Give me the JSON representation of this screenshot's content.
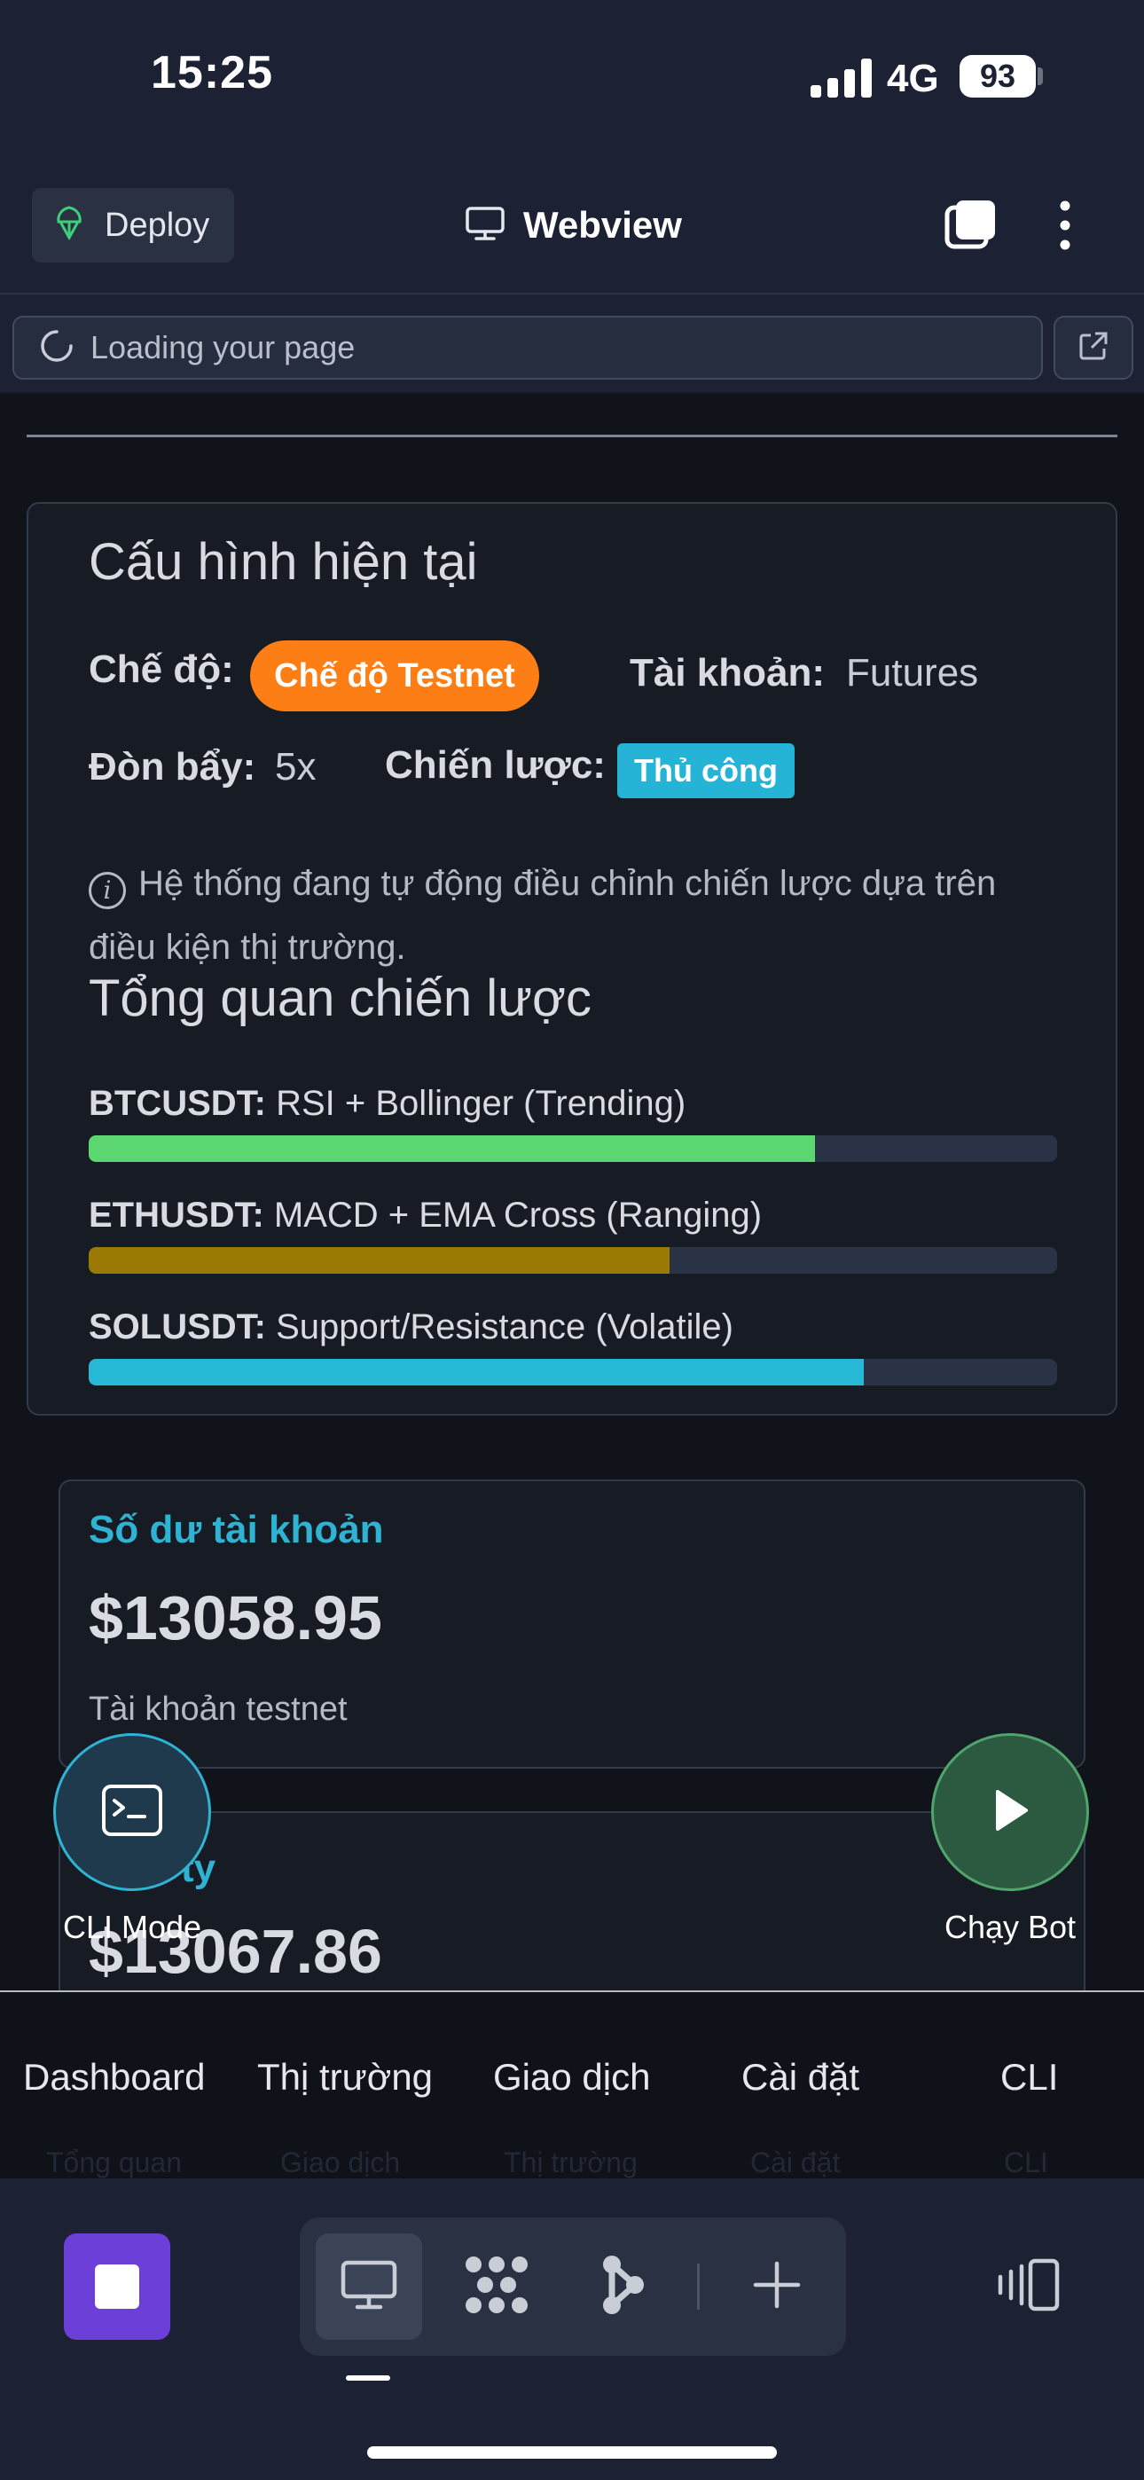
{
  "status_bar": {
    "time": "15:25",
    "network": "4G",
    "battery": "93"
  },
  "header": {
    "deploy_label": "Deploy",
    "title": "Webview"
  },
  "urlbar": {
    "text": "Loading your page"
  },
  "config": {
    "heading": "Cấu hình hiện tại",
    "mode_label": "Chế độ:",
    "mode_value": "Chế độ Testnet",
    "account_label": "Tài khoản:",
    "account_value": "Futures",
    "leverage_label": "Đòn bẩy:",
    "leverage_value": "5x",
    "strategy_label": "Chiến lược:",
    "strategy_value": "Thủ công",
    "info_text": "Hệ thống đang tự động điều chỉnh chiến lược dựa trên điều kiện thị trường.",
    "info_icon": "info-circle-icon"
  },
  "overview": {
    "heading": "Tổng quan chiến lược",
    "rows": [
      {
        "symbol": "BTCUSDT:",
        "strategy": "RSI + Bollinger (Trending)",
        "progress": 0.75,
        "color": "#5cd670"
      },
      {
        "symbol": "ETHUSDT:",
        "strategy": "MACD + EMA Cross (Ranging)",
        "progress": 0.6,
        "color": "#9a7a04"
      },
      {
        "symbol": "SOLUSDT:",
        "strategy": "Support/Resistance (Volatile)",
        "progress": 0.8,
        "color": "#27b8d6"
      }
    ]
  },
  "balance": {
    "title": "Số dư tài khoản",
    "amount": "$13058.95",
    "subtitle": "Tài khoản testnet"
  },
  "equity": {
    "title_fragment": "ty",
    "amount": "$13067.86"
  },
  "fabs": {
    "cli_label": "CLI Mode",
    "run_label": "Chạy Bot"
  },
  "app_nav": {
    "items": [
      "Dashboard",
      "Thị trường",
      "Giao dịch",
      "Cài đặt",
      "CLI"
    ],
    "ghost_items": [
      "Tổng quan",
      "Giao dịch",
      "Thị trường",
      "Cài đặt",
      "CLI"
    ]
  },
  "colors": {
    "accent_cyan": "#2fb3d3",
    "mode_orange": "#fd7e14",
    "stop_purple": "#6d3fd9"
  },
  "icons": [
    "deploy-icon",
    "monitor-icon",
    "tabs-icon",
    "more-vertical-icon",
    "loading-spinner-icon",
    "external-link-icon",
    "terminal-icon",
    "play-icon",
    "stop-icon",
    "grid-icon",
    "branch-icon",
    "plus-icon",
    "devices-icon"
  ]
}
